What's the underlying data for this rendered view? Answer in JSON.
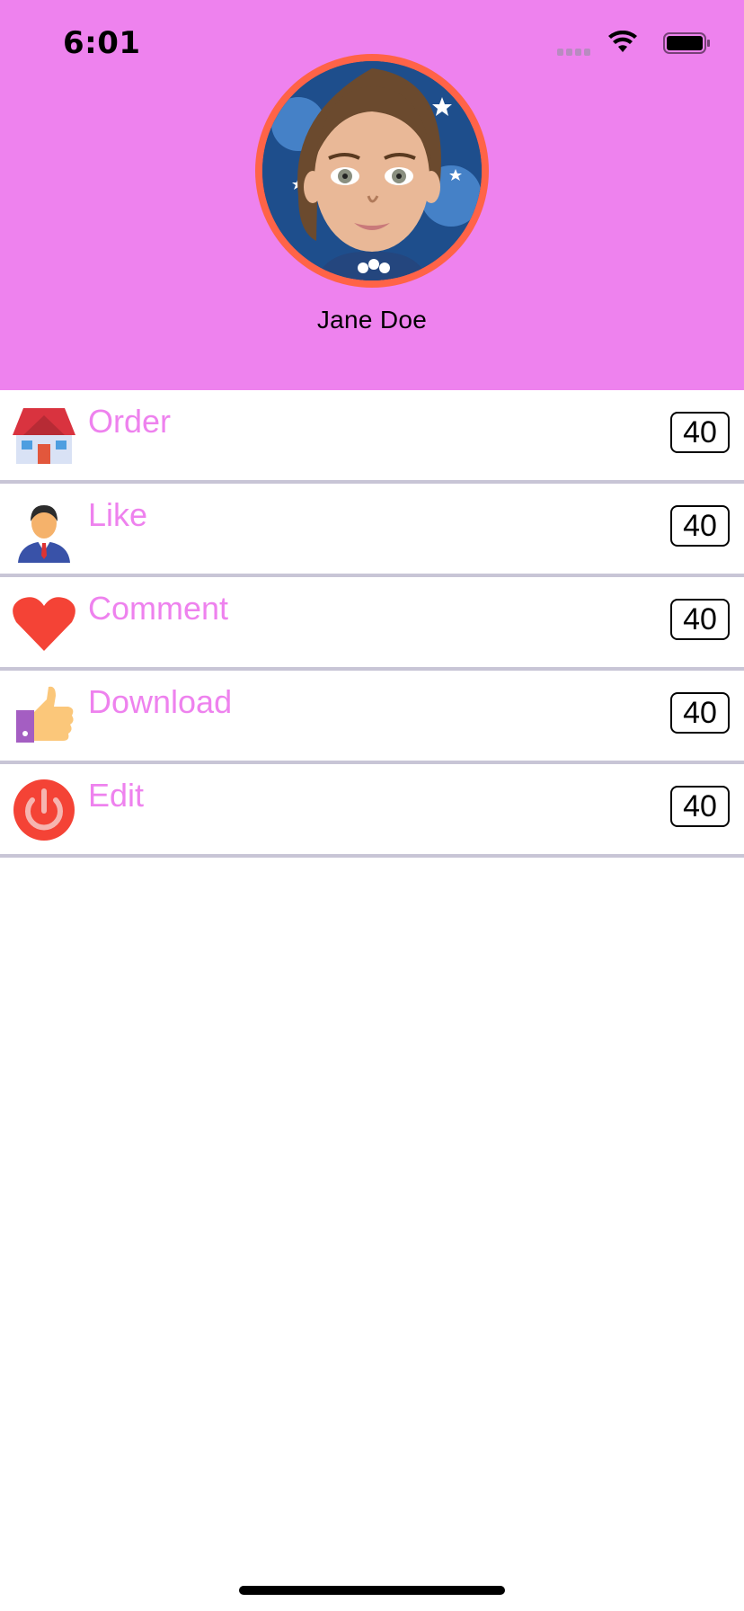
{
  "status_bar": {
    "time": "6:01"
  },
  "profile": {
    "name": "Jane Doe"
  },
  "menu": {
    "items": [
      {
        "label": "Order",
        "count": "40",
        "icon": "house-icon"
      },
      {
        "label": "Like",
        "count": "40",
        "icon": "person-icon"
      },
      {
        "label": "Comment",
        "count": "40",
        "icon": "heart-icon"
      },
      {
        "label": "Download",
        "count": "40",
        "icon": "thumbs-up-icon"
      },
      {
        "label": "Edit",
        "count": "40",
        "icon": "power-icon"
      }
    ]
  },
  "colors": {
    "header_bg": "#ee82ee",
    "label_color": "#ee82ee",
    "avatar_ring": "#ff6347",
    "divider": "#c8c5d6"
  }
}
